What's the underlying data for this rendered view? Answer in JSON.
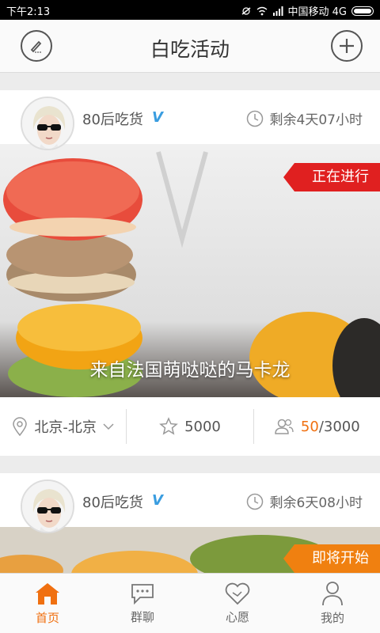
{
  "status_bar": {
    "time": "下午2:13",
    "carrier": "中国移动 4G"
  },
  "nav": {
    "title": "白吃活动",
    "left_icon": "edit-icon",
    "right_icon": "add-icon"
  },
  "cards": [
    {
      "username": "80后吃货",
      "verified_badge": "V",
      "remaining": "剩余4天07小时",
      "status": "正在进行",
      "status_color": "#e02020",
      "title": "来自法国萌哒哒的马卡龙",
      "location": "北京-北京",
      "stars": "5000",
      "joined": "50",
      "capacity": "/3000"
    },
    {
      "username": "80后吃货",
      "verified_badge": "V",
      "remaining": "剩余6天08小时",
      "status": "即将开始",
      "status_color": "#f08010"
    }
  ],
  "tabs": [
    {
      "label": "首页",
      "icon": "home-icon",
      "active": true
    },
    {
      "label": "群聊",
      "icon": "chat-icon",
      "active": false
    },
    {
      "label": "心愿",
      "icon": "heart-icon",
      "active": false
    },
    {
      "label": "我的",
      "icon": "user-icon",
      "active": false
    }
  ],
  "colors": {
    "accent": "#f07010",
    "verified": "#3a9de0"
  }
}
